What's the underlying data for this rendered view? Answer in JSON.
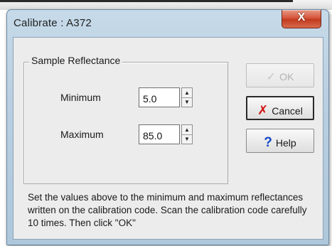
{
  "window": {
    "title": "Calibrate : A372",
    "close_glyph": "X"
  },
  "group": {
    "label": "Sample Reflectance",
    "minimum": {
      "label": "Minimum",
      "value": "5.0"
    },
    "maximum": {
      "label": "Maximum",
      "value": "85.0"
    },
    "spin_up_glyph": "▲",
    "spin_down_glyph": "▼"
  },
  "buttons": {
    "ok": {
      "label": "OK",
      "icon": "check-icon",
      "icon_glyph": "✓",
      "enabled": false
    },
    "cancel": {
      "label": "Cancel",
      "icon": "x-icon",
      "icon_glyph": "✗",
      "icon_color": "#d31212"
    },
    "help": {
      "label": "Help",
      "icon": "question-icon",
      "icon_glyph": "?",
      "icon_color": "#1645c9"
    }
  },
  "instructions": "Set the values above to the minimum and maximum reflectances written on the calibration code. Scan the calibration code carefully 10 times. Then click \"OK\""
}
